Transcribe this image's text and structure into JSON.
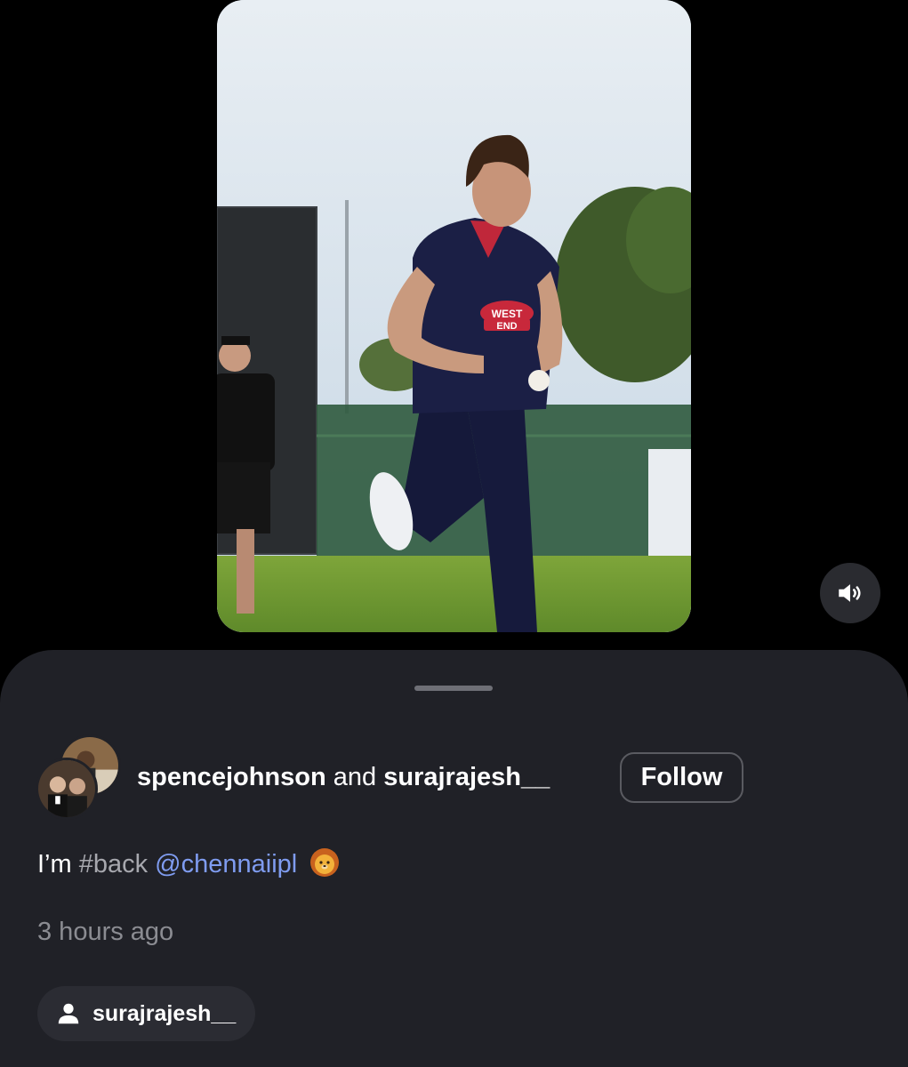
{
  "post": {
    "authors": [
      {
        "username": "spencejohnson"
      },
      {
        "username": "surajrajesh__"
      }
    ],
    "authors_joiner": "and",
    "follow_label": "Follow",
    "caption": {
      "prefix": "I’m ",
      "hashtag": "#back",
      "mention": "@chennaiipl",
      "emoji_name": "lion-face-icon"
    },
    "timestamp": "3 hours ago",
    "tagged_user": "surajrajesh__"
  },
  "video": {
    "shirt_text_line1": "WEST",
    "shirt_text_line2": "END",
    "sound_icon": "speaker-on-icon"
  },
  "colors": {
    "sheet_background": "#202127",
    "mention": "#7f9cf0",
    "muted_text": "#8b8c92"
  }
}
